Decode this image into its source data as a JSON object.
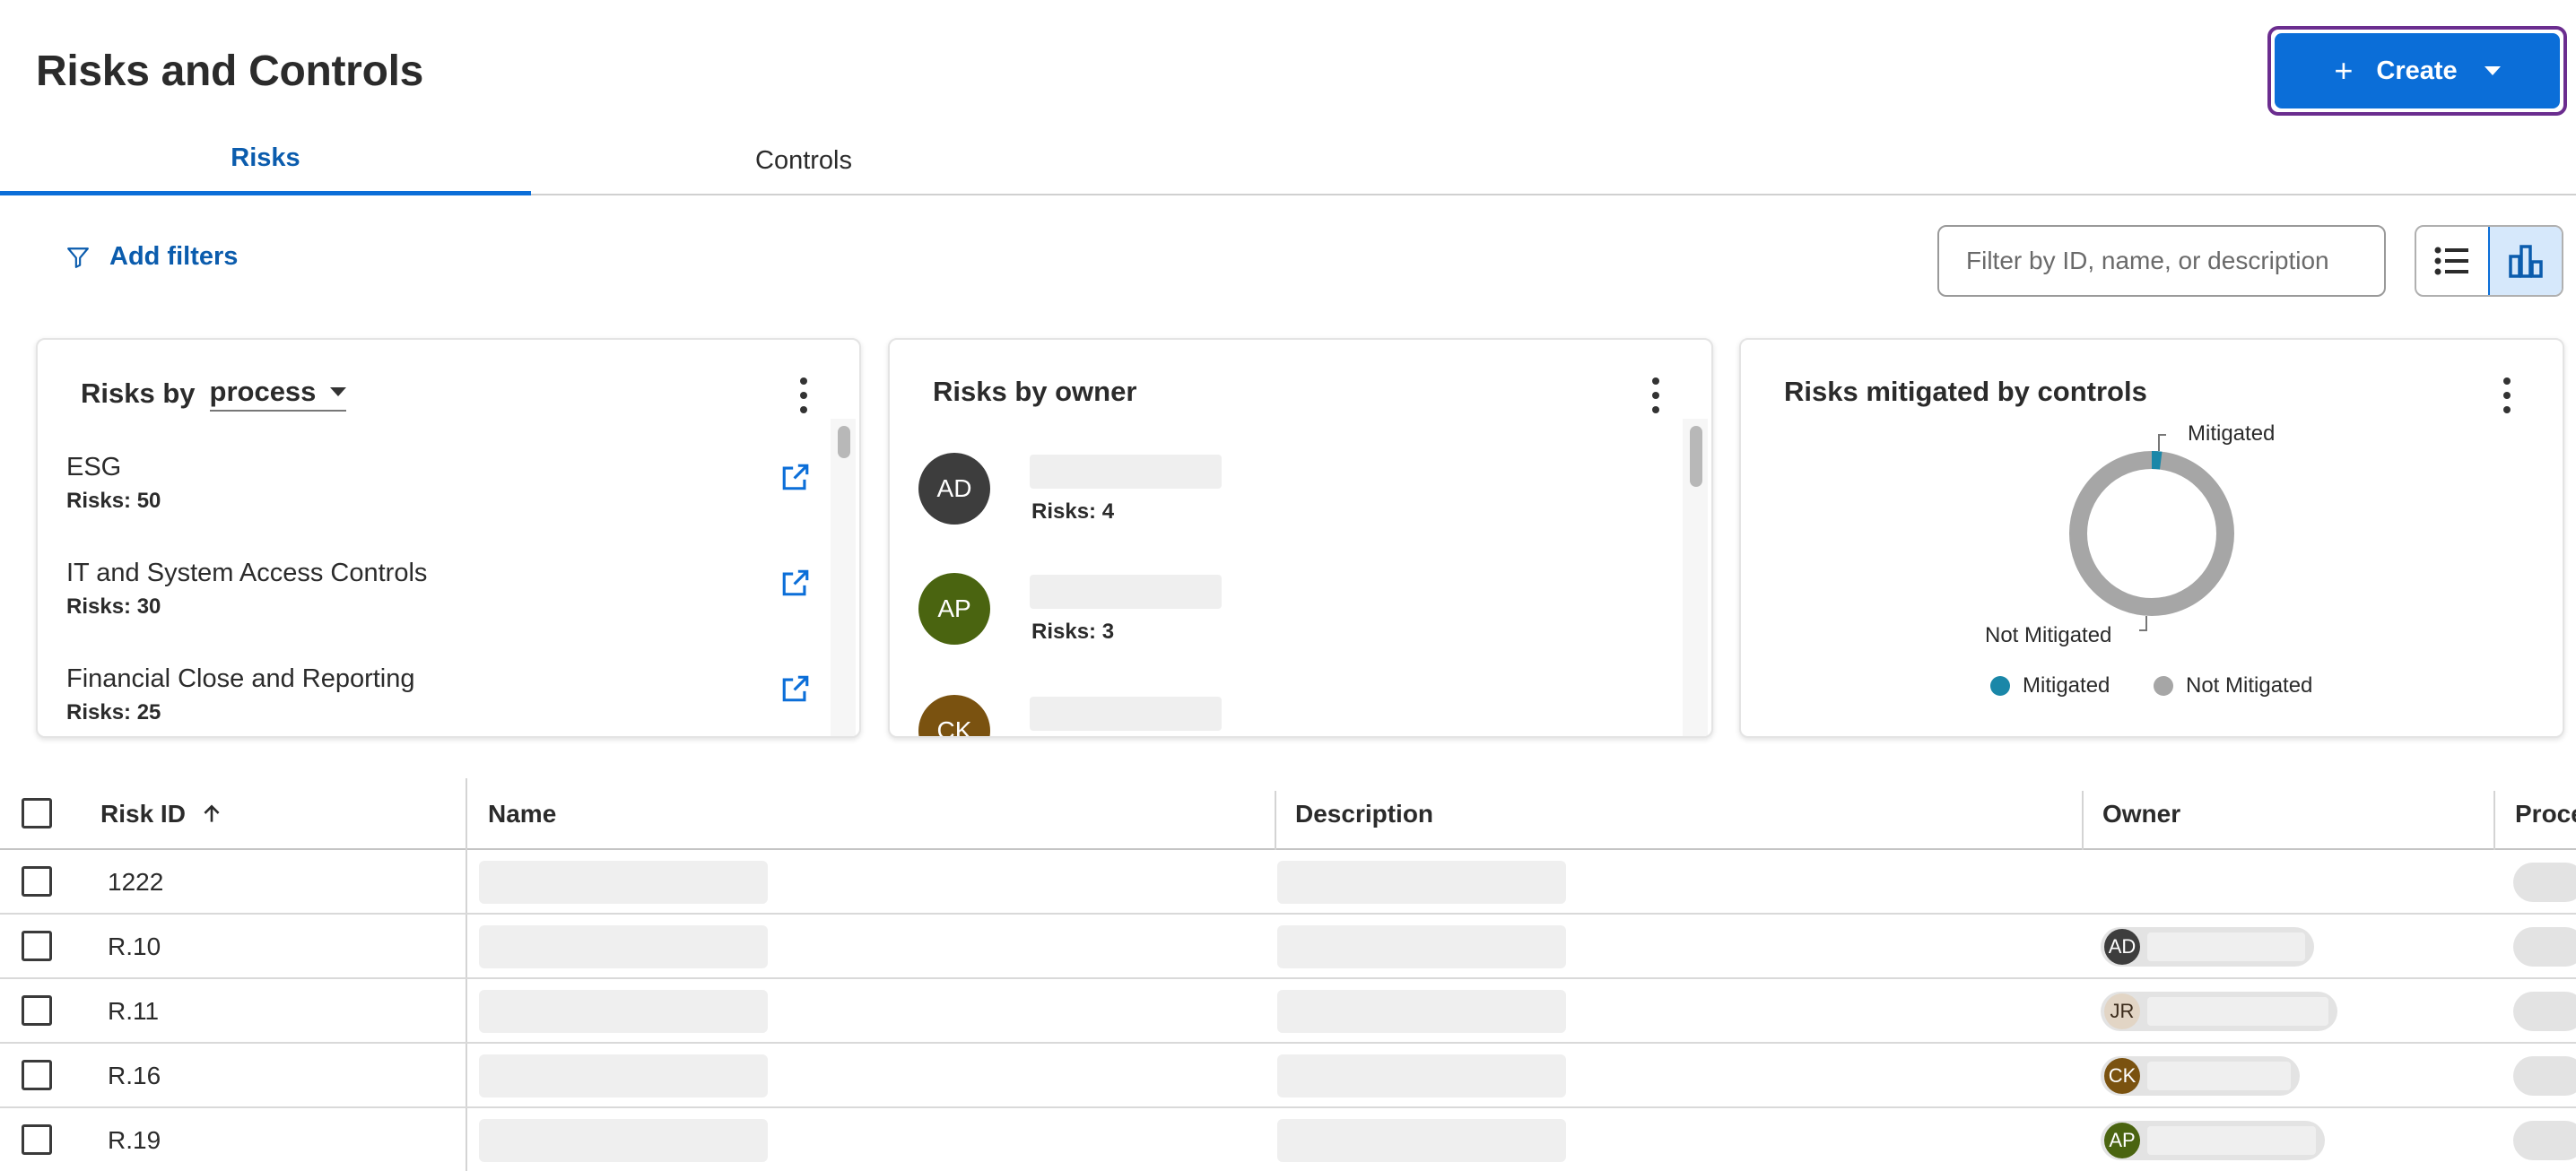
{
  "header": {
    "title": "Risks and Controls",
    "create_label": "Create"
  },
  "tabs": [
    {
      "label": "Risks",
      "active": true
    },
    {
      "label": "Controls",
      "active": false
    }
  ],
  "filters": {
    "add_filters_label": "Add filters",
    "search_placeholder": "Filter by ID, name, or description"
  },
  "cards": {
    "process": {
      "title_prefix": "Risks by",
      "selected": "process",
      "items": [
        {
          "name": "ESG",
          "count": "Risks: 50"
        },
        {
          "name": "IT and System Access Controls",
          "count": "Risks: 30"
        },
        {
          "name": "Financial Close and Reporting",
          "count": "Risks: 25"
        }
      ]
    },
    "owner": {
      "title": "Risks by owner",
      "items": [
        {
          "initials": "AD",
          "count": "Risks: 4",
          "color": "#3d3d3d"
        },
        {
          "initials": "AP",
          "count": "Risks: 3",
          "color": "#4a6410"
        },
        {
          "initials": "CK",
          "count": "",
          "color": "#7a5210"
        }
      ]
    },
    "mitigated": {
      "title": "Risks mitigated by controls",
      "mitigated_label": "Mitigated",
      "not_mitigated_label": "Not Mitigated",
      "mitigated_fraction": 0.02,
      "colors": {
        "mitigated": "#1a87a8",
        "not_mitigated": "#a6a6a6"
      }
    }
  },
  "table": {
    "columns": [
      "Risk ID",
      "Name",
      "Description",
      "Owner",
      "Proce"
    ],
    "rows": [
      {
        "id": "1222",
        "owner": ""
      },
      {
        "id": "R.10",
        "owner": "AD",
        "owner_color": "#3d3d3d"
      },
      {
        "id": "R.11",
        "owner": "JR",
        "owner_color": "#e2d5c5"
      },
      {
        "id": "R.16",
        "owner": "CK",
        "owner_color": "#7a5210"
      },
      {
        "id": "R.19",
        "owner": "AP",
        "owner_color": "#4a6410"
      }
    ]
  },
  "colors": {
    "accent": "#0b6ed8",
    "link": "#0b5cad"
  }
}
